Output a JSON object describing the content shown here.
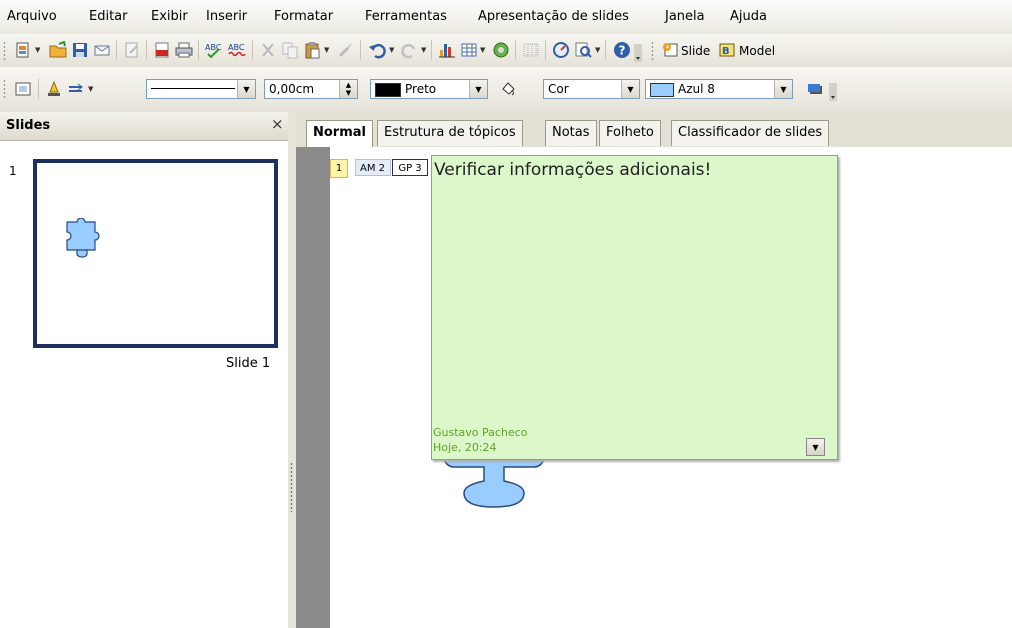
{
  "menu": [
    "Arquivo",
    "Editar",
    "Exibir",
    "Inserir",
    "Formatar",
    "Ferramentas",
    "Apresentação de slides",
    "Janela",
    "Ajuda"
  ],
  "toolbar2": {
    "line_width": "0,00cm",
    "line_color": "Preto",
    "fill_type": "Cor",
    "fill_color": "Azul 8",
    "slide_label": "Slide",
    "model_label": "Model"
  },
  "colors": {
    "line_color": "#000000",
    "fill_color": "#99ccff",
    "note_bg": "#dcf7c9",
    "note_text": "#66a02a",
    "slide_border": "#1d2f5c"
  },
  "slides_pane": {
    "title": "Slides",
    "close": "×",
    "slides": [
      {
        "number": "1",
        "caption": "Slide 1"
      }
    ]
  },
  "tabs": [
    "Normal",
    "Estrutura de tópicos",
    "Notas",
    "Folheto",
    "Classificador de slides"
  ],
  "editor": {
    "page_marker": "1",
    "author_tag_1": "AM 2",
    "author_tag_2": "GP 3"
  },
  "comment": {
    "text": "Verificar informações adicionais!",
    "author": "Gustavo Pacheco",
    "date": "Hoje, 20:24"
  }
}
